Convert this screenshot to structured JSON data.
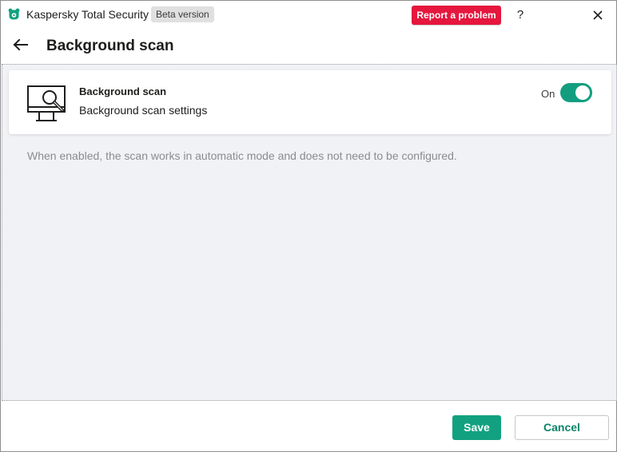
{
  "window": {
    "app_title": "Kaspersky Total Security",
    "badge": "Beta version",
    "report_button": "Report a problem",
    "help_label": "?",
    "icons": {
      "logo": "kaspersky-bear-logo-icon",
      "close": "close-icon",
      "back": "arrow-left-icon",
      "monitor": "monitor-search-icon"
    }
  },
  "header": {
    "title": "Background scan"
  },
  "card": {
    "title": "Background scan",
    "subtitle": "Background scan settings",
    "toggle_state_label": "On",
    "toggle_on": true
  },
  "info": {
    "text": "When enabled, the scan works in automatic mode and does not need to be configured."
  },
  "footer": {
    "save_label": "Save",
    "cancel_label": "Cancel"
  },
  "colors": {
    "accent_green": "#139d7f",
    "report_red": "#e5173e",
    "content_bg": "#f1f2f6",
    "muted_text": "#8b8c90"
  }
}
